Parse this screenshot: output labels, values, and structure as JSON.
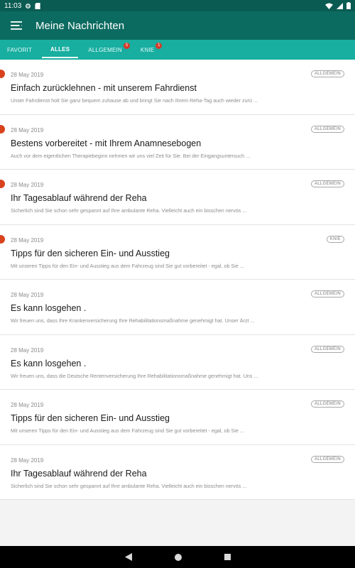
{
  "status_bar": {
    "time": "11:03"
  },
  "app_bar": {
    "title": "Meine Nachrichten"
  },
  "tabs": [
    {
      "label": "FAVORIT",
      "badge": ""
    },
    {
      "label": "ALLES",
      "badge": ""
    },
    {
      "label": "ALLGEMEIN",
      "badge": "3"
    },
    {
      "label": "KNIE",
      "badge": "1"
    }
  ],
  "active_tab": "ALLES",
  "messages": [
    {
      "date": "28 May 2019",
      "category": "ALLGEMEIN",
      "title": "Einfach zurücklehnen - mit unserem Fahrdienst",
      "preview": "Unser Fahrdienst holt Sie ganz bequem zuhause ab und bringt Sie nach Ihrem Reha-Tag auch wieder zurü ...",
      "unread": true
    },
    {
      "date": "28 May 2019",
      "category": "ALLGEMEIN",
      "title": "Bestens vorbereitet - mit Ihrem Anamnesebogen",
      "preview": "Auch vor dem eigentlichen Therapiebeginn nehmen wir uns viel Zeit für Sie. Bei der Eingangsuntersuch ...",
      "unread": true
    },
    {
      "date": "28 May 2019",
      "category": "ALLGEMEIN",
      "title": "Ihr Tagesablauf während der Reha",
      "preview": "Sicherlich sind Sie schon sehr gespannt auf Ihre ambulante Reha. Vielleicht auch ein bisschen nervös ...",
      "unread": true
    },
    {
      "date": "28 May 2019",
      "category": "KNIE",
      "title": "Tipps für den sicheren Ein- und Ausstieg",
      "preview": "Mit unseren Tipps für den Ein- und Ausstieg aus dem Fahrzeug sind Sie gut vorbereitet - egal, ob Sie ...",
      "unread": true
    },
    {
      "date": "28 May 2019",
      "category": "ALLGEMEIN",
      "title": "Es kann losgehen .",
      "preview": "Wir freuen uns, dass Ihre Krankenversicherung Ihre Rehabilitationsmaßnahme genehmigt hat. Unser Ärzt ...",
      "unread": false
    },
    {
      "date": "28 May 2019",
      "category": "ALLGEMEIN",
      "title": "Es kann losgehen .",
      "preview": "Wir freuen uns, dass die Deutsche Rentenversicherung Ihre Rehabilitationsmaßnahme genehmigt hat. Uns ...",
      "unread": false
    },
    {
      "date": "28 May 2019",
      "category": "ALLGEMEIN",
      "title": "Tipps für den sicheren Ein- und Ausstieg",
      "preview": "Mit unseren Tipps für den Ein- und Ausstieg aus dem Fahrzeug sind Sie gut vorbereitet - egal, ob Sie ...",
      "unread": false
    },
    {
      "date": "28 May 2019",
      "category": "ALLGEMEIN",
      "title": "Ihr Tagesablauf während der Reha",
      "preview": "Sicherlich sind Sie schon sehr gespannt auf Ihre ambulante Reha. Vielleicht auch ein bisschen nervös ...",
      "unread": false
    }
  ],
  "icons": {
    "menu": "hamburger-menu-icon",
    "back": "back-triangle-icon",
    "home": "home-circle-icon",
    "recents": "recents-square-icon"
  },
  "colors": {
    "status_bar": "#0a5b52",
    "app_bar": "#0c6b60",
    "tab_bar": "#18aea0",
    "badge": "#d63a2a",
    "unread_dot": "#d8421c"
  }
}
